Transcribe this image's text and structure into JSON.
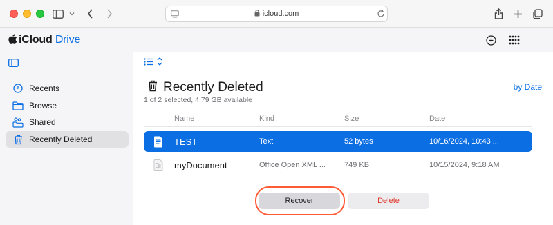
{
  "browser": {
    "url": "icloud.com"
  },
  "app": {
    "brand_prefix": "iCloud",
    "brand_suffix": "Drive"
  },
  "sidebar": {
    "items": [
      {
        "label": "Recents",
        "icon": "clock-icon"
      },
      {
        "label": "Browse",
        "icon": "folder-icon"
      },
      {
        "label": "Shared",
        "icon": "shared-folder-icon"
      },
      {
        "label": "Recently Deleted",
        "icon": "trash-icon",
        "active": true
      }
    ]
  },
  "main": {
    "title": "Recently Deleted",
    "subtitle": "1 of 2 selected, 4.79 GB available",
    "sort_label": "by Date",
    "columns": [
      "Name",
      "Kind",
      "Size",
      "Date"
    ],
    "rows": [
      {
        "name": "TEST",
        "kind": "Text",
        "size": "52 bytes",
        "date": "10/16/2024, 10:43 ...",
        "selected": true
      },
      {
        "name": "myDocument",
        "kind": "Office Open XML ...",
        "size": "749 KB",
        "date": "10/15/2024, 9:18 AM",
        "selected": false
      }
    ],
    "recover_label": "Recover",
    "delete_label": "Delete"
  },
  "colors": {
    "accent": "#0b6ee3",
    "delete_text": "#e0332a",
    "highlight_ring": "#ff5a36"
  }
}
